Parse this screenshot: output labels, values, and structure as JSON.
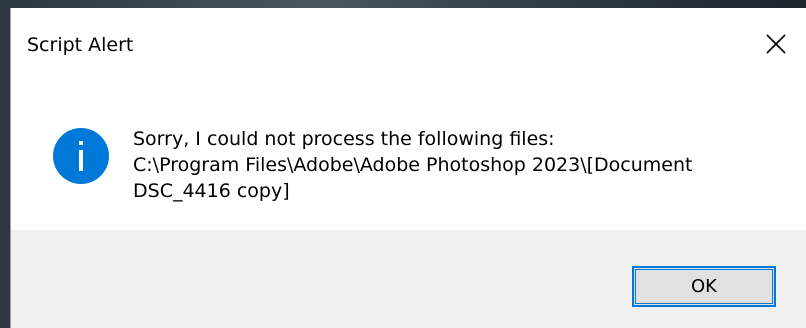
{
  "dialog": {
    "title": "Script Alert",
    "close_icon": "close-icon",
    "icon": "info-icon",
    "message_lines": [
      "Sorry, I could not process the following files:",
      "C:\\Program Files\\Adobe\\Adobe Photoshop 2023\\[Document",
      "DSC_4416 copy]"
    ],
    "ok_label": "OK"
  },
  "colors": {
    "accent": "#0078d7",
    "footer_bg": "#f0f0f0",
    "button_bg": "#e1e1e1"
  }
}
